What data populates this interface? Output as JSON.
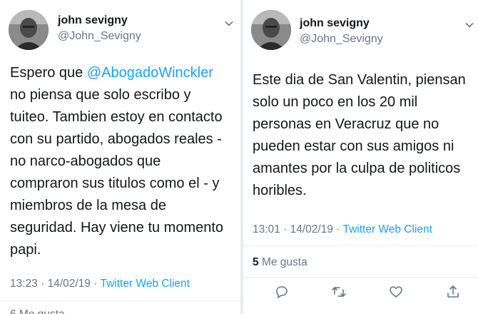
{
  "left_tweet": {
    "author_name": "john sevigny",
    "author_handle": "@John_Sevigny",
    "text_prefix": "Espero que ",
    "mention": "@AbogadoWinckler",
    "lines": [
      "no piensa que solo escribo y",
      "tuiteo. Tambien estoy en contacto",
      "con su partido, abogados reales -",
      "no narco-abogados que",
      "compraron sus titulos como el - y",
      "miembros de la mesa de",
      "seguridad. Hay viene tu momento",
      "papi."
    ],
    "time": "13:23",
    "date": "14/02/19",
    "separator": "·",
    "client": "Twitter Web Client",
    "likes_partial": "6 Me gusta"
  },
  "right_tweet": {
    "author_name": "john sevigny",
    "author_handle": "@John_Sevigny",
    "lines": [
      "Este dia de San Valentin, piensan",
      "solo un poco en los 20 mil",
      "personas en Veracruz que no",
      "pueden estar con sus amigos ni",
      "amantes por la culpa de politicos",
      "horibles."
    ],
    "time": "13:01",
    "date": "14/02/19",
    "separator": "·",
    "client": "Twitter Web Client",
    "likes_count": "5",
    "likes_label": "Me gusta"
  },
  "icons": {
    "menu": "chevron-down-icon",
    "reply": "reply-icon",
    "retweet": "retweet-icon",
    "like": "heart-icon",
    "share": "share-icon"
  },
  "colors": {
    "link": "#1da1f2",
    "secondary_text": "#657786",
    "primary_text": "#14171a",
    "divider": "#e6ecf0"
  }
}
